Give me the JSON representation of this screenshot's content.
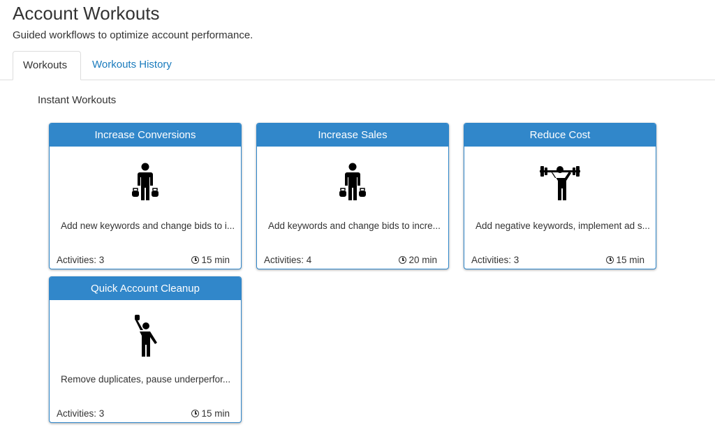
{
  "page": {
    "title": "Account Workouts",
    "subtitle": "Guided workflows to optimize account performance."
  },
  "tabs": [
    {
      "label": "Workouts",
      "active": true
    },
    {
      "label": "Workouts History",
      "active": false
    }
  ],
  "section_title": "Instant Workouts",
  "colors": {
    "card_header": "#3187ca",
    "link": "#1a7bbd"
  },
  "cards": [
    {
      "title": "Increase Conversions",
      "icon": "kettlebell-lifter-icon",
      "description": "Add new keywords and change bids to i...",
      "activities": "Activities: 3",
      "duration": "15 min"
    },
    {
      "title": "Increase Sales",
      "icon": "kettlebell-lifter-icon",
      "description": "Add keywords and change bids to incre...",
      "activities": "Activities: 4",
      "duration": "20 min"
    },
    {
      "title": "Reduce Cost",
      "icon": "barbell-lifter-icon",
      "description": "Add negative keywords, implement ad s...",
      "activities": "Activities: 3",
      "duration": "15 min"
    },
    {
      "title": "Quick Account Cleanup",
      "icon": "arm-raise-icon",
      "description": "Remove duplicates, pause underperfor...",
      "activities": "Activities: 3",
      "duration": "15 min"
    }
  ]
}
